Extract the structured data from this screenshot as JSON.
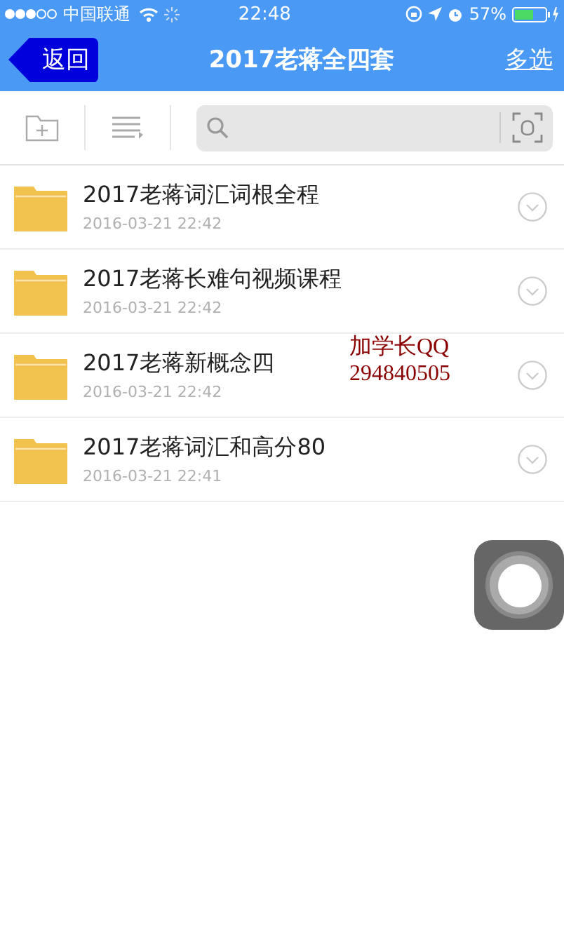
{
  "status_bar": {
    "carrier": "中国联通",
    "time": "22:48",
    "battery": "57%"
  },
  "nav": {
    "back": "返回",
    "title": "2017老蒋全四套",
    "action": "多选"
  },
  "files": [
    {
      "name": "2017老蒋词汇词根全程",
      "date": "2016-03-21 22:42"
    },
    {
      "name": "2017老蒋长难句视频课程",
      "date": "2016-03-21 22:42"
    },
    {
      "name": "2017老蒋新概念四",
      "date": "2016-03-21 22:42"
    },
    {
      "name": "2017老蒋词汇和高分80",
      "date": "2016-03-21 22:41"
    }
  ],
  "overlay_note": [
    "加学长QQ",
    "294840505"
  ]
}
